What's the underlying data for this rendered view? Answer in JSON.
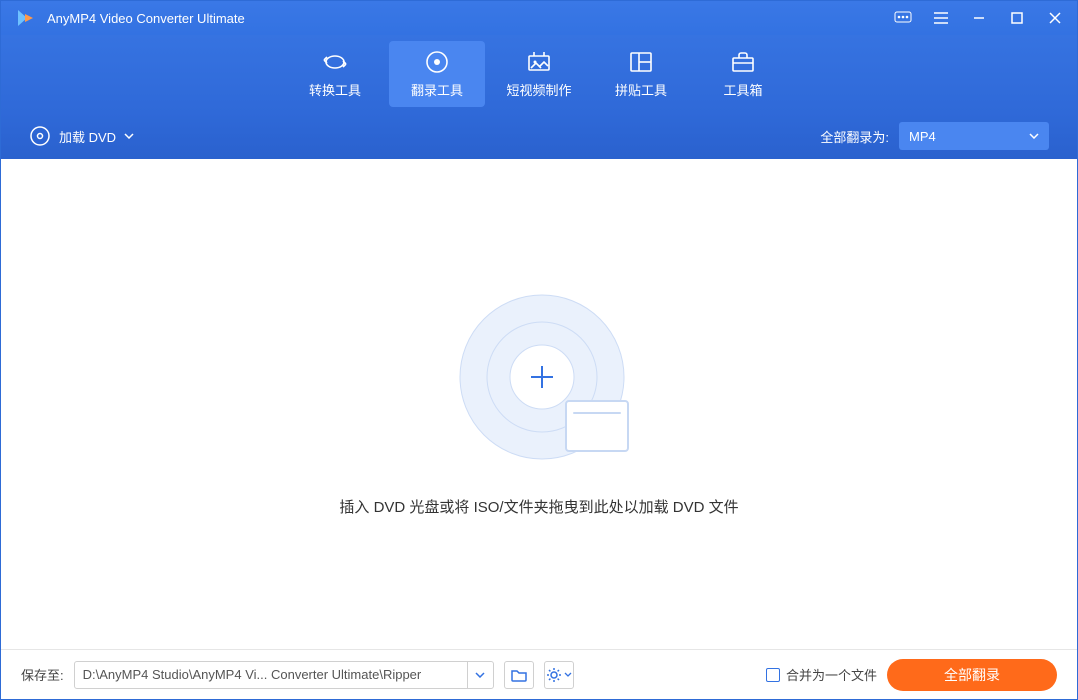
{
  "app": {
    "title": "AnyMP4 Video Converter Ultimate"
  },
  "nav": {
    "items": [
      {
        "label": "转换工具"
      },
      {
        "label": "翻录工具"
      },
      {
        "label": "短视频制作"
      },
      {
        "label": "拼贴工具"
      },
      {
        "label": "工具箱"
      }
    ]
  },
  "subbar": {
    "load_label": "加载 DVD",
    "format_label": "全部翻录为:",
    "format_value": "MP4"
  },
  "main": {
    "hint": "插入 DVD 光盘或将 ISO/文件夹拖曳到此处以加载 DVD 文件"
  },
  "footer": {
    "save_to_label": "保存至:",
    "save_path": "D:\\AnyMP4 Studio\\AnyMP4 Vi... Converter Ultimate\\Ripper",
    "merge_label": "合并为一个文件",
    "rip_all_label": "全部翻录"
  }
}
